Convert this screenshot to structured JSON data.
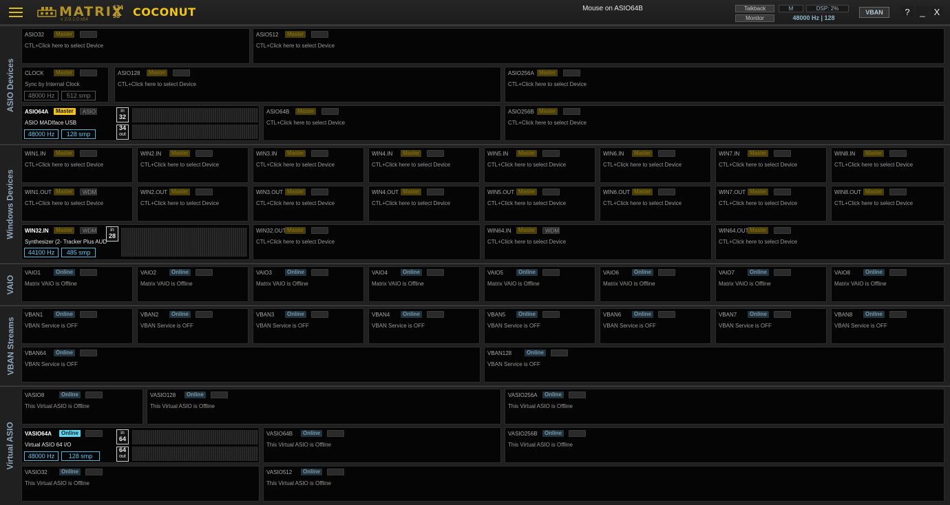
{
  "header": {
    "logo_text": "MATRIX",
    "logo_num_top": "124",
    "logo_num_bottom": "98",
    "version": "v 2.0.1.0 x64",
    "edition": "COCONUT",
    "mouse_status": "Mouse on ASIO64B",
    "talkback_label": "Talkback",
    "monitor_label": "Monitor",
    "m_label": "M",
    "dsp_label": "DSP: 2%",
    "rate_readout": "48000 Hz | 128",
    "vban_label": "VBAN",
    "help_label": "?",
    "minimize_label": "_",
    "close_label": "X"
  },
  "labels": {
    "master": "Master",
    "online": "Online",
    "wdm": "WDM",
    "asio": "ASIO",
    "select_device": "CTL+Click here to select Device",
    "vaio_offline": "Matrix VAIO is Offline",
    "vban_off": "VBAN Service is OFF",
    "vasio_offline": "This Virtual ASIO is Offline",
    "in": "in",
    "out": "out"
  },
  "sections": {
    "asio": "ASIO Devices",
    "windows": "Windows Devices",
    "vaio": "VAIO",
    "vban": "VBAN Streams",
    "vasio": "Virtual ASIO"
  },
  "asio": {
    "asio32": "ASIO32",
    "asio512": "ASIO512",
    "clock": "CLOCK",
    "clock_desc": "Sync by Internal Clock",
    "clock_rate": "48000 Hz",
    "clock_buffer": "512 smp",
    "asio128": "ASIO128",
    "asio256a": "ASIO256A",
    "asio64a": "ASIO64A",
    "asio64a_desc": "ASIO MADIface USB",
    "asio64a_rate": "48000 Hz",
    "asio64a_buffer": "128 smp",
    "asio64a_in": "32",
    "asio64a_out": "34",
    "asio64b": "ASIO64B",
    "asio256b": "ASIO256B"
  },
  "windows": {
    "in": [
      "WIN1.IN",
      "WIN2.IN",
      "WIN3.IN",
      "WIN4.IN",
      "WIN5.IN",
      "WIN6.IN",
      "WIN7.IN",
      "WIN8.IN"
    ],
    "out": [
      "WIN1.OUT",
      "WIN2.OUT",
      "WIN3.OUT",
      "WIN4.OUT",
      "WIN5.OUT",
      "WIN6.OUT",
      "WIN7.OUT",
      "WIN8.OUT"
    ],
    "win32in": "WIN32.IN",
    "win32in_desc": "Synthesizer (2- Tracker Plus AUD",
    "win32in_rate": "44100 Hz",
    "win32in_buffer": "485 smp",
    "win32in_in": "28",
    "win32out": "WIN32.OUT",
    "win64in": "WIN64.IN",
    "win64out": "WIN64.OUT"
  },
  "vaio": [
    "VAIO1",
    "VAIO2",
    "VAIO3",
    "VAIO4",
    "VAIO5",
    "VAIO6",
    "VAIO7",
    "VAIO8"
  ],
  "vban": {
    "row": [
      "VBAN1",
      "VBAN2",
      "VBAN3",
      "VBAN4",
      "VBAN5",
      "VBAN6",
      "VBAN7",
      "VBAN8"
    ],
    "vban64": "VBAN64",
    "vban128": "VBAN128"
  },
  "vasio": {
    "vasio8": "VASIO8",
    "vasio128": "VASIO128",
    "vasio256a": "VASIO256A",
    "vasio64a": "VASIO64A",
    "vasio64a_desc": "Virtual ASIO 64 I/O",
    "vasio64a_rate": "48000 Hz",
    "vasio64a_buffer": "128 smp",
    "vasio64a_in": "64",
    "vasio64a_out": "64",
    "vasio64b": "VASIO64B",
    "vasio256b": "VASIO256B",
    "vasio32": "VASIO32",
    "vasio512": "VASIO512"
  }
}
